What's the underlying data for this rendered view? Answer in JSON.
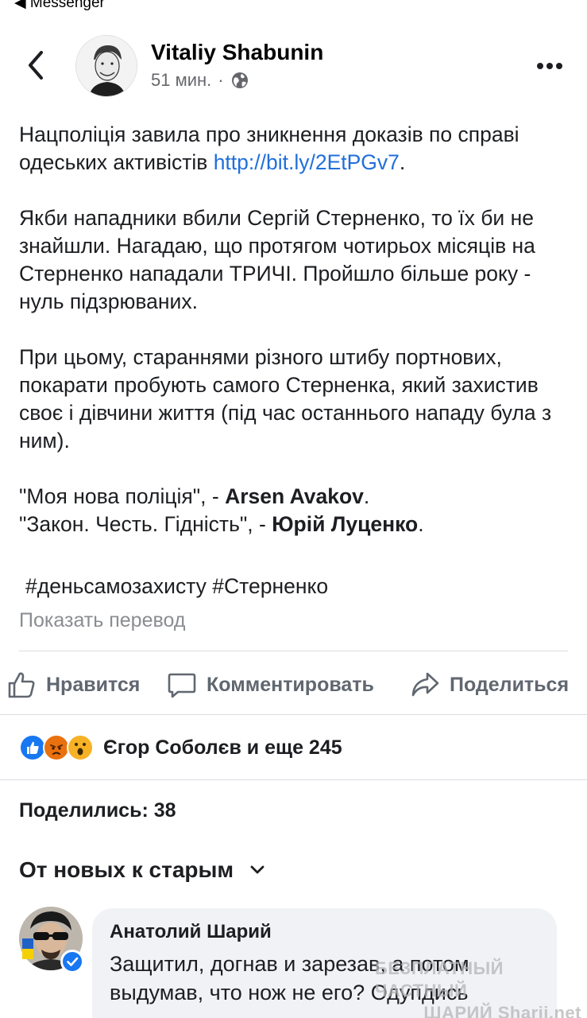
{
  "status_bar": {
    "back_app": "◀ Messenger"
  },
  "post": {
    "author": "Vitaliy Shabunin",
    "time": "51 мин.",
    "separator": "·",
    "paragraph1_text": "Нацполіція завила про зникнення доказів по справі одеських активістів ",
    "paragraph1_link": "http://bit.ly/2EtPGv7",
    "paragraph1_end": ".",
    "paragraph2": "Якби нападники вбили Сергій Стерненко, то їх би не знайшли. Нагадаю, що протягом чотирьох місяців на Стерненко нападали ТРИЧІ. Пройшло більше року - нуль підзрюваних.",
    "paragraph3": "При цьому, стараннями різного штибу портнових, покарати пробують самого Стерненка, який захистив своє і дівчини життя (під час останнього нападу була з ним).",
    "quote1_text": "\"Моя нова поліція\", - ",
    "quote1_name": "Arsen Avakov",
    "quote1_end": ".",
    "quote2_text": "\"Закон. Честь. Гідність\", - ",
    "quote2_name": "Юрій Луценко",
    "quote2_end": ".",
    "hashtags": "#деньсамозахисту #Стерненко",
    "translate": "Показать перевод"
  },
  "actions": {
    "like": "Нравится",
    "comment": "Комментировать",
    "share": "Поделиться"
  },
  "reactions": {
    "text": "Єгор Соболєв и еще 245",
    "colors": {
      "like": "#1877f2",
      "angry": "#e9710f",
      "wow": "#f7b125"
    }
  },
  "shares": "Поделились: 38",
  "sort": {
    "label": "От новых к старым"
  },
  "comment": {
    "author": "Анатолий Шарий",
    "text": "Защитил, догнав и зарезав, а потом выдумав, что нож не его? Одупдись"
  },
  "watermark": {
    "line1": "БЕЗПЛАТНЫЙ ЧАСТНЫЙ",
    "line2": "ШАРИЙ Sharij.net"
  }
}
